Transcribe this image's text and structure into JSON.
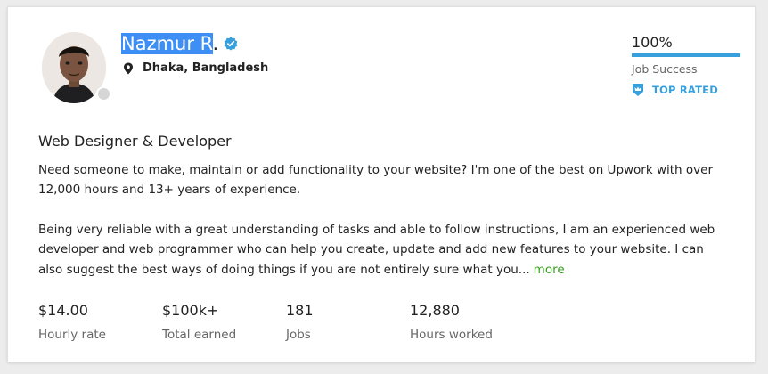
{
  "profile": {
    "name_highlighted": "Nazmur R",
    "name_rest": ".",
    "location": "Dhaka, Bangladesh",
    "title": "Web Designer & Developer",
    "description_p1": "Need someone to make, maintain or add functionality to your website? I'm one of the best on Upwork with over 12,000 hours and 13+ years of experience.",
    "description_p2": "Being very reliable with a great understanding of tasks and able to follow instructions, I am an experienced web developer and web programmer who can help you create, update and add new features to your website. I can also suggest the best ways of doing things if you are not entirely sure what you...",
    "more_link": "more"
  },
  "job_success": {
    "value": "100%",
    "value_fraction": 1.0,
    "label": "Job Success",
    "badge_label": "TOP RATED"
  },
  "stats": [
    {
      "value": "$14.00",
      "label": "Hourly rate"
    },
    {
      "value": "$100k+",
      "label": "Total earned"
    },
    {
      "value": "181",
      "label": "Jobs"
    },
    {
      "value": "12,880",
      "label": "Hours worked"
    }
  ],
  "icons": {
    "verified": "verified-check-icon",
    "location": "map-pin-icon",
    "badge": "top-rated-badge-icon"
  },
  "colors": {
    "accent_blue": "#37a0dc",
    "more_link_green": "#37a01e",
    "selection_highlight": "#3d8ff5"
  }
}
